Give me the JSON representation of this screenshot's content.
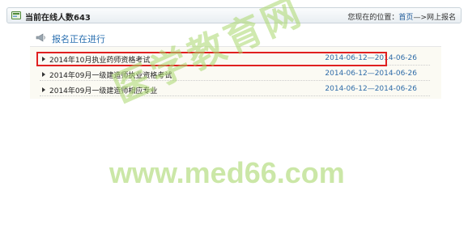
{
  "topbar": {
    "online_label": "当前在线人数643",
    "location_prefix": "您现在的位置：",
    "breadcrumb_home": "首页",
    "breadcrumb_separator": "—>",
    "breadcrumb_current": "网上报名"
  },
  "panel": {
    "title": "报名正在进行",
    "items": [
      {
        "title": "2014年10月执业药师资格考试",
        "dates": "2014-06-12—2014-06-26",
        "highlighted": true
      },
      {
        "title": "2014年09月一级建造师执业资格考试",
        "dates": "2014-06-12—2014-06-26",
        "highlighted": false
      },
      {
        "title": "2014年09月一级建造师相应专业",
        "dates": "2014-06-12—2014-06-26",
        "highlighted": false
      }
    ]
  },
  "watermark": {
    "chinese": "医学教育网",
    "url": "www.med66.com"
  },
  "colors": {
    "link": "#1f5a99",
    "date": "#2f6ca8",
    "panel_title": "#2a6fb0",
    "highlight": "#e02020",
    "watermark": "#aad76e"
  }
}
